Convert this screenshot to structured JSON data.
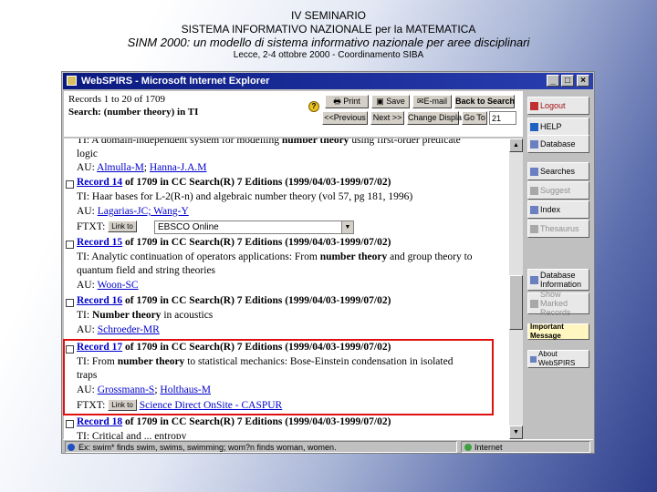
{
  "slide": {
    "line1": "IV SEMINARIO",
    "line2": "SISTEMA INFORMATIVO NAZIONALE per la MATEMATICA",
    "line3": "SINM 2000: un modello di sistema informativo nazionale per aree disciplinari",
    "line4": "Lecce, 2-4 ottobre 2000 - Coordinamento SIBA"
  },
  "window": {
    "title": "WebSPIRS - Microsoft Internet Explorer",
    "min": "_",
    "max": "□",
    "close": "×"
  },
  "query": {
    "records_line": "Records 1 to 20 of 1709",
    "search_line": "Search: (number theory) in TI"
  },
  "toolbar": {
    "print": "Print",
    "save": "Save",
    "email": "E-mail",
    "back": "Back to Search",
    "prev": "<<Previous",
    "next": "Next >>",
    "change_display": "Change Display",
    "goto": "Go To",
    "goto_value": "21"
  },
  "sidebar": {
    "items": [
      {
        "label": "Logout"
      },
      {
        "label": "HELP"
      },
      {
        "label": "Database"
      },
      {
        "label": "Searches"
      },
      {
        "label": "Suggest"
      },
      {
        "label": "Index"
      },
      {
        "label": "Thesaurus"
      },
      {
        "label": "Database Information"
      },
      {
        "label": "Show Marked Records"
      },
      {
        "label": "Important Message"
      },
      {
        "label": "About WebSPIRS"
      }
    ]
  },
  "results": {
    "r13": {
      "ti_a": "TI: A domain-independent system for modelling ",
      "ti_b": "number theory",
      "ti_c": " using first-order predicate",
      "ti_d": "logic",
      "au_prefix": "AU: ",
      "au1": "Almulla-M",
      "au2": "Hanna-J.A.M"
    },
    "r14": {
      "rec": "Record 14",
      "rest": " of 1709 in CC Search(R) 7 Editions (1999/04/03-1999/07/02)",
      "ti": "TI: Haar bases for L-2(R-n) and algebraic number theory (vol 57, pg 181, 1996)",
      "au_prefix": "AU: ",
      "au": "Lagarias-JC; Wang-Y",
      "ftxt": "FTXT:",
      "linkto": "Link to",
      "select": "EBSCO Online"
    },
    "r15": {
      "rec": "Record 15",
      "rest": " of 1709 in CC Search(R) 7 Editions (1999/04/03-1999/07/02)",
      "ti_a": "TI: Analytic continuation of operators applications: From ",
      "ti_b": "number theory",
      "ti_c": " and group theory to",
      "ti_d": "quantum field and string theories",
      "au_prefix": "AU: ",
      "au": "Woon-SC"
    },
    "r16": {
      "rec": "Record 16",
      "rest": " of 1709 in CC Search(R) 7 Editions (1999/04/03-1999/07/02)",
      "ti_a": "TI: ",
      "ti_b": "Number theory",
      "ti_c": " in acoustics",
      "au_prefix": "AU: ",
      "au": "Schroeder-MR"
    },
    "r17": {
      "rec": "Record 17",
      "rest": " of 1709 in CC Search(R) 7 Editions (1999/04/03-1999/07/02)",
      "ti_a": "TI: From ",
      "ti_b": "number theory",
      "ti_c": " to statistical mechanics: Bose-Einstein condensation in isolated",
      "ti_d": "traps",
      "au_prefix": "AU: ",
      "au1": "Grossmann-S",
      "au2": "Holthaus-M",
      "ftxt": "FTXT:",
      "linkto": "Link to",
      "ftxt_link": "Science Direct OnSite - CASPUR"
    },
    "r18": {
      "rec": "Record 18",
      "rest": " of 1709 in CC Search(R) 7 Editions (1999/04/03-1999/07/02)",
      "ti": "TI: Critical and ... entropy"
    }
  },
  "status": {
    "left": "Ex: swim* finds swim, swims, swimming; wom?n finds woman, women.",
    "right": "Internet"
  }
}
